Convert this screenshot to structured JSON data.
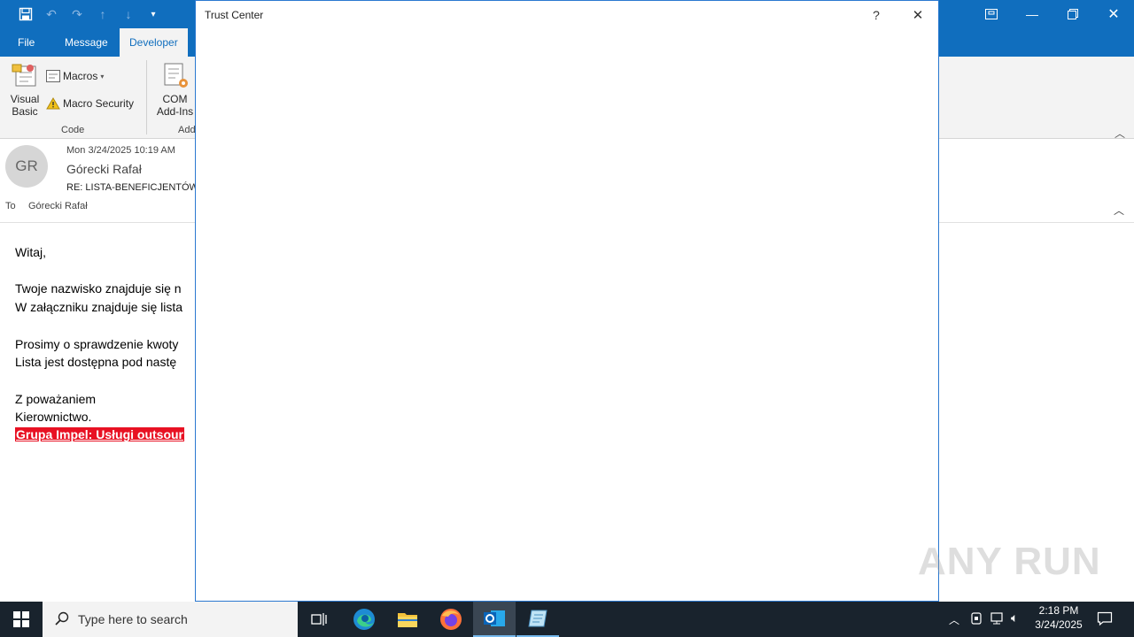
{
  "ribbon": {
    "tabs": [
      "File",
      "Message",
      "Developer"
    ],
    "visual_basic_line1": "Visual",
    "visual_basic_line2": "Basic",
    "macros": "Macros",
    "macro_security": "Macro Security",
    "group_code": "Code",
    "com_line1": "COM",
    "com_line2": "Add-Ins",
    "group_addins_partial": "Add"
  },
  "message": {
    "avatar_initials": "GR",
    "date": "Mon 3/24/2025 10:19 AM",
    "sender": "Górecki Rafał",
    "subject": "RE: LISTA-BENEFICJENTÓW",
    "to_label": "To",
    "to_value": "Górecki Rafał",
    "body": {
      "greeting": "Witaj,",
      "line1": "Twoje nazwisko znajduje się n",
      "line2": "W załączniku znajduje się lista",
      "line3": "Prosimy o sprawdzenie kwoty",
      "line4": "Lista jest dostępna pod nastę",
      "closing1": "Z poważaniem",
      "closing2": "Kierownictwo.",
      "link": "Grupa Impel: Usługi outsour"
    }
  },
  "dialog": {
    "title": "Trust Center",
    "help": "?",
    "close": "✕"
  },
  "taskbar": {
    "search_placeholder": "Type here to search",
    "time": "2:18 PM",
    "date": "3/24/2025"
  },
  "watermark": "ANY RUN",
  "colors": {
    "accent": "#106ebe",
    "taskbar": "#19232d",
    "link_bg": "#e81123"
  }
}
